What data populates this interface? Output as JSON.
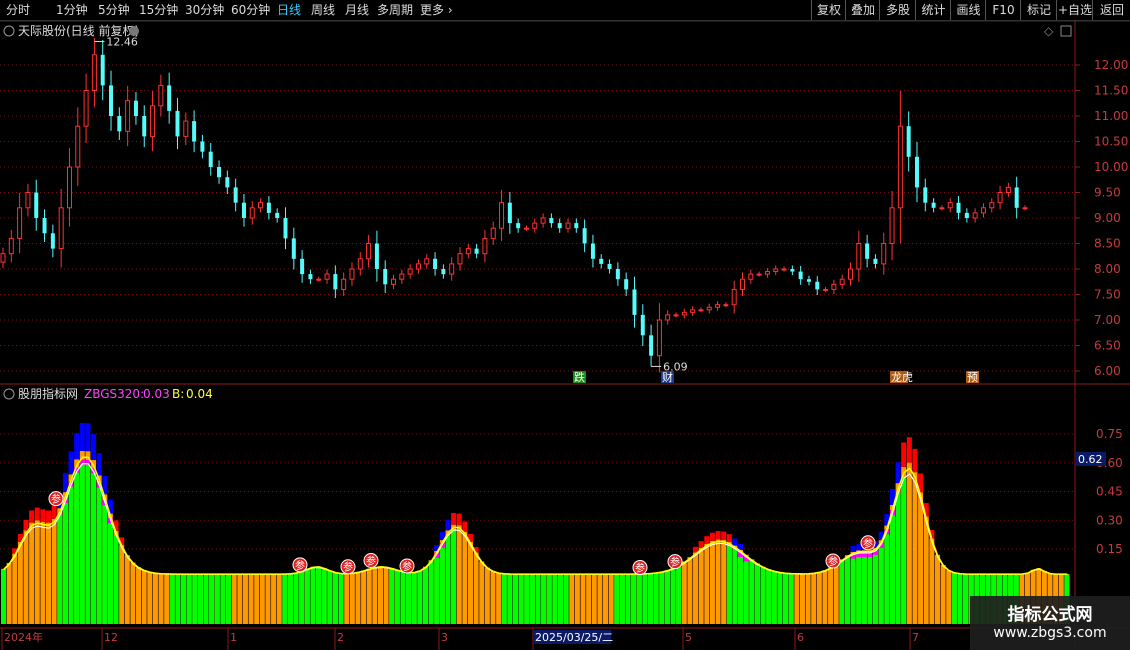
{
  "toolbar": {
    "left": [
      {
        "label": "分时",
        "active": false
      },
      {
        "label": "1分钟",
        "active": false
      },
      {
        "label": "5分钟",
        "active": false
      },
      {
        "label": "15分钟",
        "active": false
      },
      {
        "label": "30分钟",
        "active": false
      },
      {
        "label": "60分钟",
        "active": false
      },
      {
        "label": "日线",
        "active": true
      },
      {
        "label": "周线",
        "active": false
      },
      {
        "label": "月线",
        "active": false
      },
      {
        "label": "多周期",
        "active": false
      },
      {
        "label": "更多",
        "active": false
      }
    ],
    "right": [
      "复权",
      "叠加",
      "多股",
      "统计",
      "画线",
      "F10",
      "标记",
      "+自选",
      "返回"
    ]
  },
  "main_panel": {
    "title": "天际股份(日线 前复权)",
    "high_label": "12.46",
    "low_label": "6.09",
    "price_ticks": [
      "12.00",
      "11.50",
      "11.00",
      "10.50",
      "10.00",
      "9.50",
      "9.00",
      "8.50",
      "8.00",
      "7.50",
      "7.00",
      "6.50",
      "6.00"
    ],
    "markers": [
      "跌",
      "财",
      "龙虎",
      "预"
    ]
  },
  "indicator_panel": {
    "title": "股朋指标网",
    "zbgs_label": "ZBGS320:",
    "zbgs_value": "0.03",
    "b_label": "B:",
    "b_value": "0.04",
    "ticks": [
      "0.75",
      "0.60",
      "0.45",
      "0.30",
      "0.15"
    ],
    "current_value": "0.62",
    "badge_char": "参"
  },
  "x_axis": {
    "labels": [
      "2024年",
      "12",
      "1",
      "2",
      "3",
      "2025/03/25/二",
      "5",
      "6",
      "7"
    ]
  },
  "watermark": {
    "line1": "指标公式网",
    "line2": "www.zbgs3.com"
  },
  "colors": {
    "up": "#ff3232",
    "down": "#54fcfc",
    "green": "#00ff00",
    "orange": "#ff9900",
    "red": "#ff0000",
    "blue": "#0000ff",
    "magenta": "#ff00ff",
    "yellow": "#ffff00",
    "grid": "#7a1010"
  },
  "chart_data": {
    "type": "candlestick",
    "ylim": [
      6.0,
      12.46
    ],
    "closes": [
      8.3,
      8.6,
      9.2,
      9.5,
      9.0,
      8.7,
      8.4,
      9.2,
      10.0,
      10.8,
      11.5,
      12.2,
      11.6,
      11.0,
      10.7,
      11.3,
      11.0,
      10.6,
      11.2,
      11.6,
      11.1,
      10.6,
      10.9,
      10.5,
      10.3,
      10.0,
      9.8,
      9.6,
      9.3,
      9.0,
      9.2,
      9.3,
      9.1,
      9.0,
      8.6,
      8.2,
      7.9,
      7.8,
      7.8,
      7.9,
      7.6,
      7.8,
      8.0,
      8.2,
      8.5,
      8.0,
      7.7,
      7.8,
      7.9,
      8.0,
      8.1,
      8.2,
      8.0,
      7.9,
      8.1,
      8.3,
      8.4,
      8.3,
      8.6,
      8.8,
      9.3,
      8.9,
      8.8,
      8.8,
      8.9,
      9.0,
      8.9,
      8.8,
      8.9,
      8.8,
      8.5,
      8.2,
      8.1,
      8.0,
      7.8,
      7.6,
      7.1,
      6.7,
      6.3,
      7.0,
      7.1,
      7.1,
      7.15,
      7.2,
      7.2,
      7.25,
      7.3,
      7.3,
      7.6,
      7.8,
      7.9,
      7.9,
      7.95,
      8.0,
      8.0,
      7.95,
      7.8,
      7.75,
      7.6,
      7.6,
      7.7,
      7.8,
      8.0,
      8.5,
      8.2,
      8.1,
      8.5,
      9.2,
      10.8,
      10.2,
      9.6,
      9.3,
      9.2,
      9.2,
      9.3,
      9.1,
      9.0,
      9.1,
      9.2,
      9.3,
      9.5,
      9.6,
      9.2,
      9.2
    ]
  }
}
